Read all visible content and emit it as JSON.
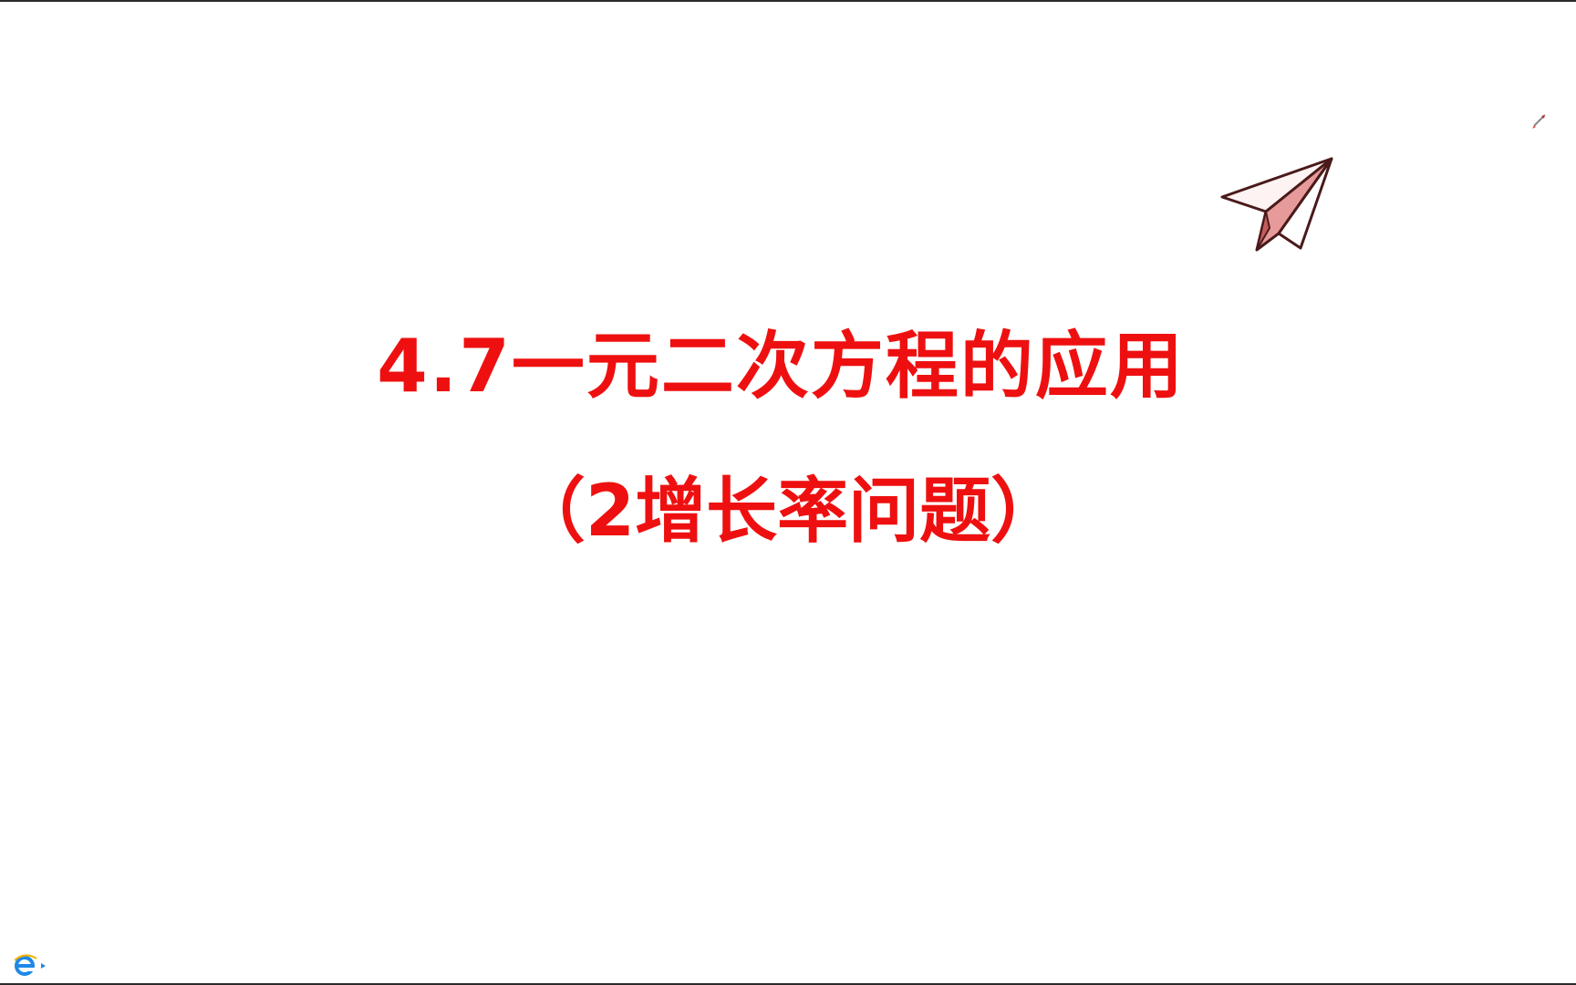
{
  "slide": {
    "title": "4.7一元二次方程的应用",
    "subtitle": "（2增长率问题）",
    "accent_color": "#ee1010"
  },
  "icons": {
    "plane": "paper-plane-icon",
    "pen": "pen-cursor-icon",
    "ie": "ie-logo-icon"
  }
}
